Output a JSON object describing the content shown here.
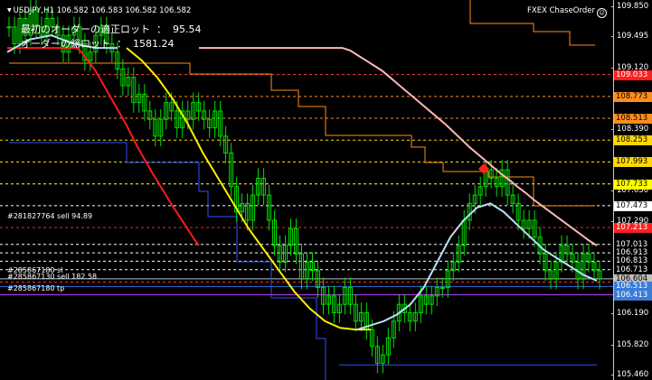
{
  "header": {
    "symbol_line": "USDJPY,H1  106.582 106.583 106.582 106.582",
    "info_line1": "最初のオーダーの適正ロット  ：  95.54",
    "info_line2": "オーダーの総ロット  ：  1581.24",
    "ea_name": "FXEX ChaseOrder"
  },
  "price_axis": {
    "ticks": [
      {
        "label": "109.850",
        "price": 109.85
      },
      {
        "label": "109.495",
        "price": 109.495
      },
      {
        "label": "109.120",
        "price": 109.12
      },
      {
        "label": "108.390",
        "price": 108.39
      },
      {
        "label": "107.650",
        "price": 107.65
      },
      {
        "label": "107.290",
        "price": 107.29
      },
      {
        "label": "106.190",
        "price": 106.19
      },
      {
        "label": "105.820",
        "price": 105.82
      },
      {
        "label": "105.460",
        "price": 105.46
      }
    ],
    "badges": [
      {
        "label": "109.033",
        "price": 109.033,
        "bg": "#ff2020",
        "fg": "#ffffff"
      },
      {
        "label": "108.773",
        "price": 108.773,
        "bg": "#ff8c1a",
        "fg": "#000000"
      },
      {
        "label": "108.513",
        "price": 108.513,
        "bg": "#ff8c1a",
        "fg": "#000000"
      },
      {
        "label": "108.253",
        "price": 108.253,
        "bg": "#ffd700",
        "fg": "#000000"
      },
      {
        "label": "107.993",
        "price": 107.993,
        "bg": "#ffd700",
        "fg": "#000000"
      },
      {
        "label": "107.733",
        "price": 107.733,
        "bg": "#ffff00",
        "fg": "#000000"
      },
      {
        "label": "107.473",
        "price": 107.473,
        "bg": "#ffffff",
        "fg": "#000000"
      },
      {
        "label": "107.213",
        "price": 107.213,
        "bg": "#ff2020",
        "fg": "#ffffff"
      },
      {
        "label": "107.013",
        "price": 107.013,
        "bg": "#000000",
        "fg": "#ffffff"
      },
      {
        "label": "106.913",
        "price": 106.913,
        "bg": "#000000",
        "fg": "#ffffff"
      },
      {
        "label": "106.813",
        "price": 106.813,
        "bg": "#000000",
        "fg": "#ffffff"
      },
      {
        "label": "106.713",
        "price": 106.713,
        "bg": "#000000",
        "fg": "#ffffff"
      },
      {
        "label": "106.604",
        "price": 106.604,
        "bg": "#c0c0c0",
        "fg": "#000000"
      },
      {
        "label": "106.513",
        "price": 106.513,
        "bg": "#3a7bd5",
        "fg": "#ffffff"
      },
      {
        "label": "106.413",
        "price": 106.413,
        "bg": "#3a7bd5",
        "fg": "#ffffff"
      }
    ]
  },
  "order_labels": [
    {
      "text": "#281827764 sell 94.89",
      "price": 107.29
    },
    {
      "text": "#285867180 sl",
      "price": 106.65
    },
    {
      "text": "#285867130 sell 182.58",
      "price": 106.565
    },
    {
      "text": "#285867180 tp",
      "price": 106.43
    }
  ],
  "levels": [
    {
      "price": 109.033,
      "color": "#ff3b3b",
      "style": "dash"
    },
    {
      "price": 108.773,
      "color": "#ff8c1a",
      "style": "dash"
    },
    {
      "price": 108.513,
      "color": "#ff8c1a",
      "style": "dash"
    },
    {
      "price": 108.253,
      "color": "#ffd700",
      "style": "dash"
    },
    {
      "price": 107.993,
      "color": "#ffd700",
      "style": "dash"
    },
    {
      "price": 107.733,
      "color": "#ffff66",
      "style": "dash"
    },
    {
      "price": 107.473,
      "color": "#ffffff",
      "style": "dash"
    },
    {
      "price": 107.213,
      "color": "#ff2020",
      "style": "dash"
    },
    {
      "price": 107.013,
      "color": "#ffffff",
      "style": "dash"
    },
    {
      "price": 106.913,
      "color": "#ffffff",
      "style": "dash"
    },
    {
      "price": 106.813,
      "color": "#ffffff",
      "style": "dash"
    },
    {
      "price": 106.713,
      "color": "#ffffff",
      "style": "dash"
    },
    {
      "price": 106.604,
      "color": "#c0c0c0",
      "style": "solid"
    },
    {
      "price": 106.565,
      "color": "#ff3030",
      "style": "dash"
    },
    {
      "price": 106.513,
      "color": "#2f6fd6",
      "style": "solid"
    },
    {
      "price": 106.413,
      "color": "#c040ff",
      "style": "solid"
    }
  ],
  "colors": {
    "candles": "#00dd00",
    "ma_red": "#ff1a1a",
    "ma_pink": "#ffb6b6",
    "ma_yellow": "#ffee00",
    "ma_lightblue": "#b8e0f5",
    "stair_orange": "#ff8c1a",
    "stair_blue": "#2f4fff"
  },
  "series": {
    "close": [
      109.6,
      109.4,
      109.7,
      109.5,
      109.8,
      109.6,
      109.5,
      109.7,
      109.6,
      109.5,
      109.3,
      109.5,
      109.6,
      109.4,
      109.2,
      109.3,
      109.5,
      109.6,
      109.4,
      109.3,
      109.1,
      108.9,
      109.0,
      108.7,
      108.8,
      108.6,
      108.5,
      108.3,
      108.5,
      108.7,
      108.6,
      108.4,
      108.6,
      108.5,
      108.7,
      108.6,
      108.5,
      108.4,
      108.6,
      108.3,
      108.1,
      107.7,
      107.4,
      107.5,
      107.3,
      107.6,
      107.8,
      107.6,
      107.3,
      107.0,
      106.8,
      107.0,
      107.2,
      106.9,
      106.6,
      106.8,
      106.7,
      106.5,
      106.3,
      106.4,
      106.2,
      106.3,
      106.5,
      106.3,
      106.1,
      106.2,
      106.0,
      105.8,
      105.6,
      105.7,
      105.9,
      106.1,
      106.3,
      106.2,
      106.1,
      106.2,
      106.4,
      106.3,
      106.4,
      106.5,
      106.5,
      106.7,
      106.8,
      107.0,
      107.3,
      107.5,
      107.6,
      107.7,
      107.9,
      107.8,
      107.7,
      107.9,
      107.6,
      107.5,
      107.3,
      107.2,
      107.3,
      107.1,
      106.9,
      106.7,
      106.6,
      106.8,
      107.0,
      106.9,
      106.8,
      106.6,
      106.9,
      106.8,
      106.7,
      106.6
    ],
    "ma_red": [
      109.35,
      109.35,
      109.35,
      109.35,
      109.35,
      109.35,
      109.35,
      109.35,
      109.35,
      109.35,
      109.35,
      109.35,
      109.35,
      109.35,
      109.35,
      109.35,
      109.35,
      109.35,
      109.35,
      109.32,
      109.26,
      109.2,
      109.14,
      109.08,
      109.0,
      108.92,
      108.84,
      108.76,
      108.68,
      108.6,
      108.52,
      108.44,
      108.35,
      108.26,
      108.17,
      108.09,
      108.01,
      107.93,
      107.85,
      107.78,
      107.7,
      107.63,
      107.55,
      107.48,
      107.41,
      107.34,
      107.27,
      107.2,
      107.13,
      107.06,
      107.0
    ],
    "ma_yellow": [
      109.35,
      109.2,
      109.0,
      108.75,
      108.45,
      108.1,
      107.8,
      107.5,
      107.2,
      106.95,
      106.7,
      106.45,
      106.25,
      106.1,
      106.02,
      106.0,
      106.0
    ],
    "ma_lightblue": [
      106.0,
      106.05,
      106.1,
      106.18,
      106.3,
      106.5,
      106.8,
      107.1,
      107.3,
      107.45,
      107.5,
      107.4,
      107.25,
      107.1,
      106.95,
      106.85,
      106.75,
      106.65,
      106.58
    ]
  }
}
